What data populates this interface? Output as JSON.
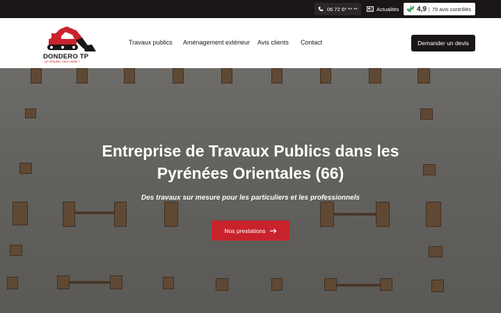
{
  "topbar": {
    "phone": "06 72 6* ** **",
    "news_label": "Actualités",
    "rating_score": "4,9",
    "rating_sep": "|",
    "rating_count": "79 avis contrôlés",
    "icons": [
      "phone-icon",
      "newspaper-icon",
      "verified-reviews-icon"
    ]
  },
  "header": {
    "logo_text": "DONDERO TP",
    "logo_tagline": "Un chantier, mon métier !",
    "nav": [
      {
        "label": "Travaux publics"
      },
      {
        "label": "Aménagement extérieur"
      },
      {
        "label": "Avis clients"
      },
      {
        "label": "Contact"
      }
    ],
    "cta_label": "Demander un devis"
  },
  "hero": {
    "title": "Entreprise de Travaux Publics dans les Pyrénées Orientales (66)",
    "subtitle": "Des travaux sur mesure pour les particuliers et les professionnels",
    "button_label": "Nos prestations",
    "button_icon": "arrow-right-icon"
  },
  "colors": {
    "brand_red": "#c8232c",
    "dark": "#1b1616",
    "white": "#ffffff"
  }
}
